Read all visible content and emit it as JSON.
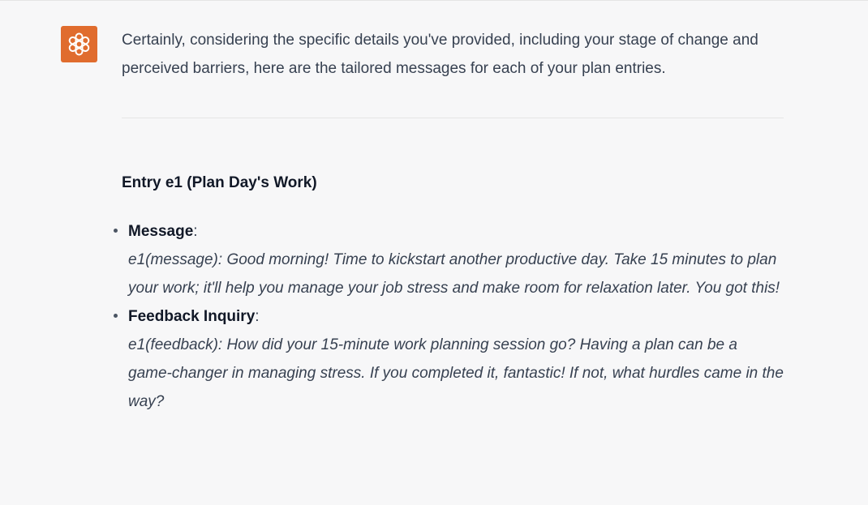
{
  "assistant": {
    "avatar_icon": "openai-logo-icon",
    "avatar_color": "#e06c2e"
  },
  "message": {
    "intro": "Certainly, considering the specific details you've provided, including your stage of change and perceived barriers, here are the tailored messages for each of your plan entries.",
    "entry_heading": "Entry e1 (Plan Day's Work)",
    "items": [
      {
        "title": "Message",
        "separator": ":",
        "body": "e1(message): Good morning! Time to kickstart another productive day. Take 15 minutes to plan your work; it'll help you manage your job stress and make room for relaxation later. You got this!"
      },
      {
        "title": "Feedback Inquiry",
        "separator": ":",
        "body": "e1(feedback): How did your 15-minute work planning session go? Having a plan can be a game-changer in managing stress. If you completed it, fantastic! If not, what hurdles came in the way?"
      }
    ]
  }
}
